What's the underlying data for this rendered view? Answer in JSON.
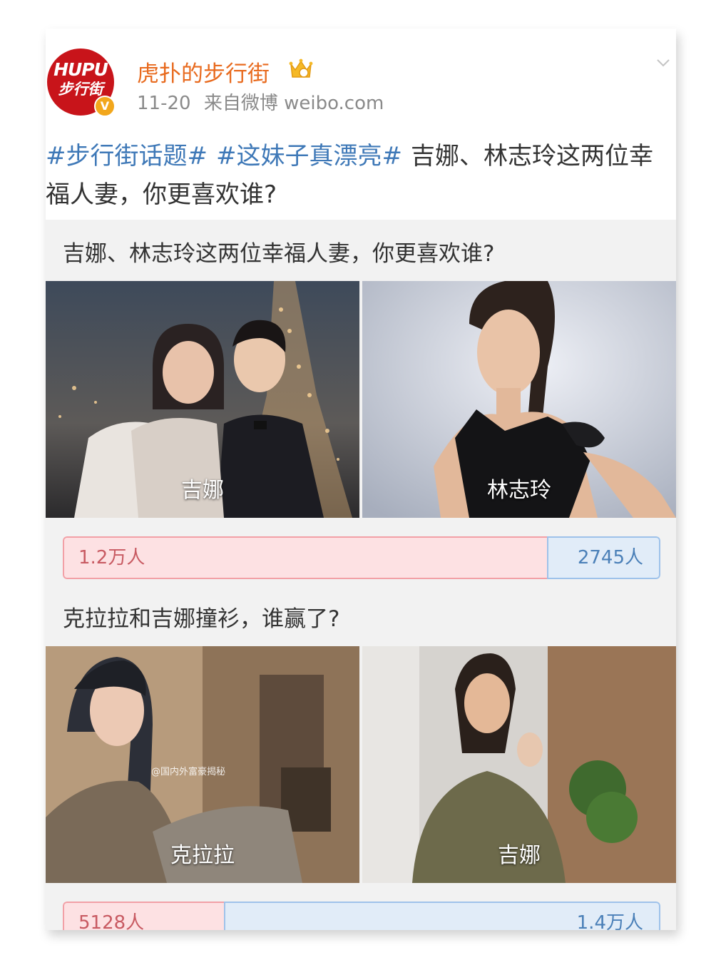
{
  "account": {
    "name": "虎扑的步行街",
    "avatar_line1": "HUPU",
    "avatar_line2": "步行街",
    "date": "11-20",
    "source": "来自微博 weibo.com"
  },
  "post": {
    "tags": [
      "#步行街话题#",
      "#这妹子真漂亮#"
    ],
    "text": "吉娜、林志玲这两位幸福人妻，你更喜欢谁?"
  },
  "polls": [
    {
      "question": "吉娜、林志玲这两位幸福人妻，你更喜欢谁?",
      "option_a": "吉娜",
      "option_b": "林志玲",
      "votes_a": "1.2万人",
      "votes_b": "2745人",
      "share_a": 0.81
    },
    {
      "question": "克拉拉和吉娜撞衫，谁赢了?",
      "option_a": "克拉拉",
      "option_b": "吉娜",
      "votes_a": "5128人",
      "votes_b": "1.4万人",
      "share_a": 0.27
    }
  ],
  "watermark": "@国内外富豪揭秘",
  "colors": {
    "username": "#e86a1e",
    "hashtag": "#3e78b7",
    "vote_a_fill": "#fde1e3",
    "vote_b_fill": "#e1ecf8"
  }
}
